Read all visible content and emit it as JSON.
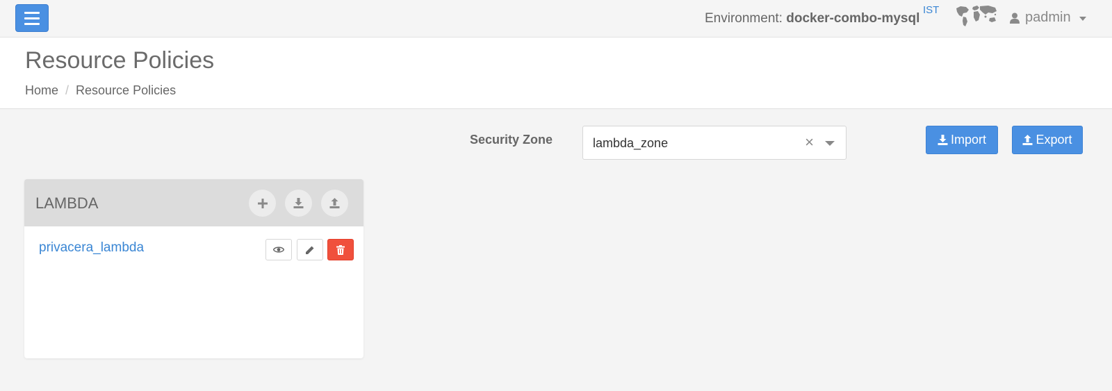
{
  "topbar": {
    "environment_label": "Environment:",
    "environment_name": "docker-combo-mysql",
    "timezone": "IST",
    "username": "padmin"
  },
  "header": {
    "title": "Resource Policies",
    "breadcrumb": [
      "Home",
      "Resource Policies"
    ]
  },
  "zone": {
    "label": "Security Zone",
    "value": "lambda_zone",
    "clear_glyph": "×"
  },
  "actions": {
    "import_label": "Import",
    "export_label": "Export"
  },
  "service_card": {
    "title": "LAMBDA",
    "services": [
      {
        "name": "privacera_lambda"
      }
    ]
  },
  "colors": {
    "primary": "#4a90e2",
    "danger": "#f0503c",
    "link": "#3a86d4"
  }
}
